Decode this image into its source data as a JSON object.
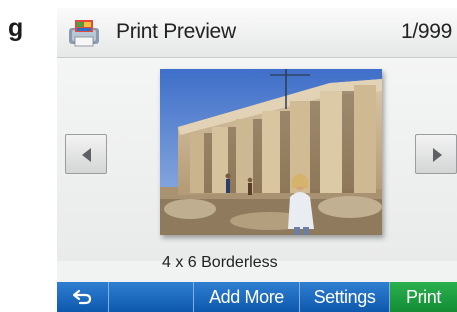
{
  "figure_label": "g",
  "header": {
    "title": "Print Preview",
    "counter": "1/999",
    "icon": "print-app-icon"
  },
  "preview": {
    "caption": "4 x 6 Borderless",
    "prev_icon": "triangle-left-icon",
    "next_icon": "triangle-right-icon"
  },
  "toolbar": {
    "back_icon": "back-arrow-icon",
    "add_more_label": "Add More",
    "settings_label": "Settings",
    "print_label": "Print"
  },
  "colors": {
    "toolbar_blue": "#1a6cc4",
    "print_green": "#1f9e42"
  }
}
